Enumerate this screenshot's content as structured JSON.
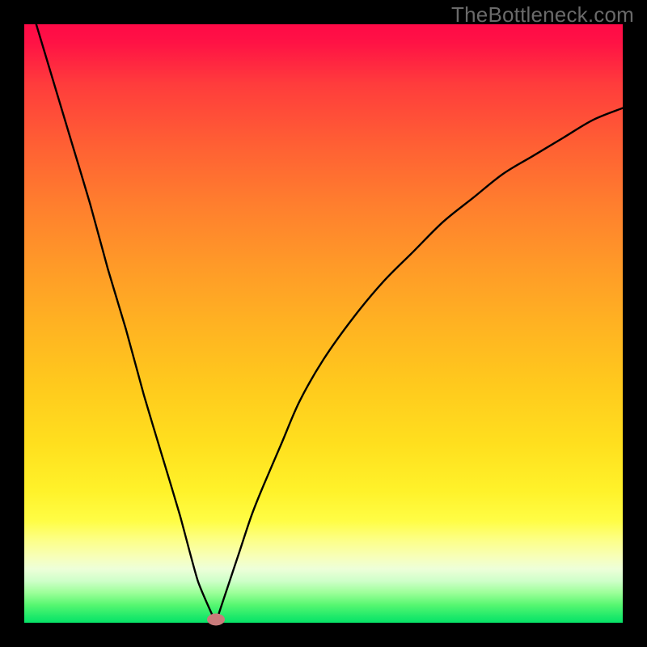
{
  "watermark": "TheBottleneck.com",
  "chart_data": {
    "type": "line",
    "title": "",
    "xlabel": "",
    "ylabel": "",
    "xlim": [
      0,
      100
    ],
    "ylim": [
      0,
      100
    ],
    "grid": false,
    "legend_visible": false,
    "background_gradient": {
      "top_color": "#ff0a47",
      "bottom_color": "#07e368",
      "description": "vertical red-to-green gradient (high=bad, low=good)"
    },
    "series": [
      {
        "name": "left-branch",
        "x": [
          2,
          5,
          8,
          11,
          14,
          17,
          20,
          23,
          26,
          29,
          32
        ],
        "y": [
          100,
          90,
          80,
          70,
          59,
          49,
          38,
          28,
          18,
          7,
          0
        ]
      },
      {
        "name": "right-branch",
        "x": [
          32,
          34,
          36,
          38,
          40,
          43,
          46,
          50,
          55,
          60,
          65,
          70,
          75,
          80,
          85,
          90,
          95,
          100
        ],
        "y": [
          0,
          6,
          12,
          18,
          23,
          30,
          37,
          44,
          51,
          57,
          62,
          67,
          71,
          75,
          78,
          81,
          84,
          86
        ]
      }
    ],
    "annotations": [
      {
        "name": "optimal-marker",
        "x": 32,
        "y": 0.5,
        "shape": "ellipse",
        "color": "#c97b7b"
      }
    ]
  },
  "colors": {
    "frame": "#000000",
    "curve": "#000000",
    "marker": "#c97b7b",
    "watermark": "#6a6a6a"
  }
}
